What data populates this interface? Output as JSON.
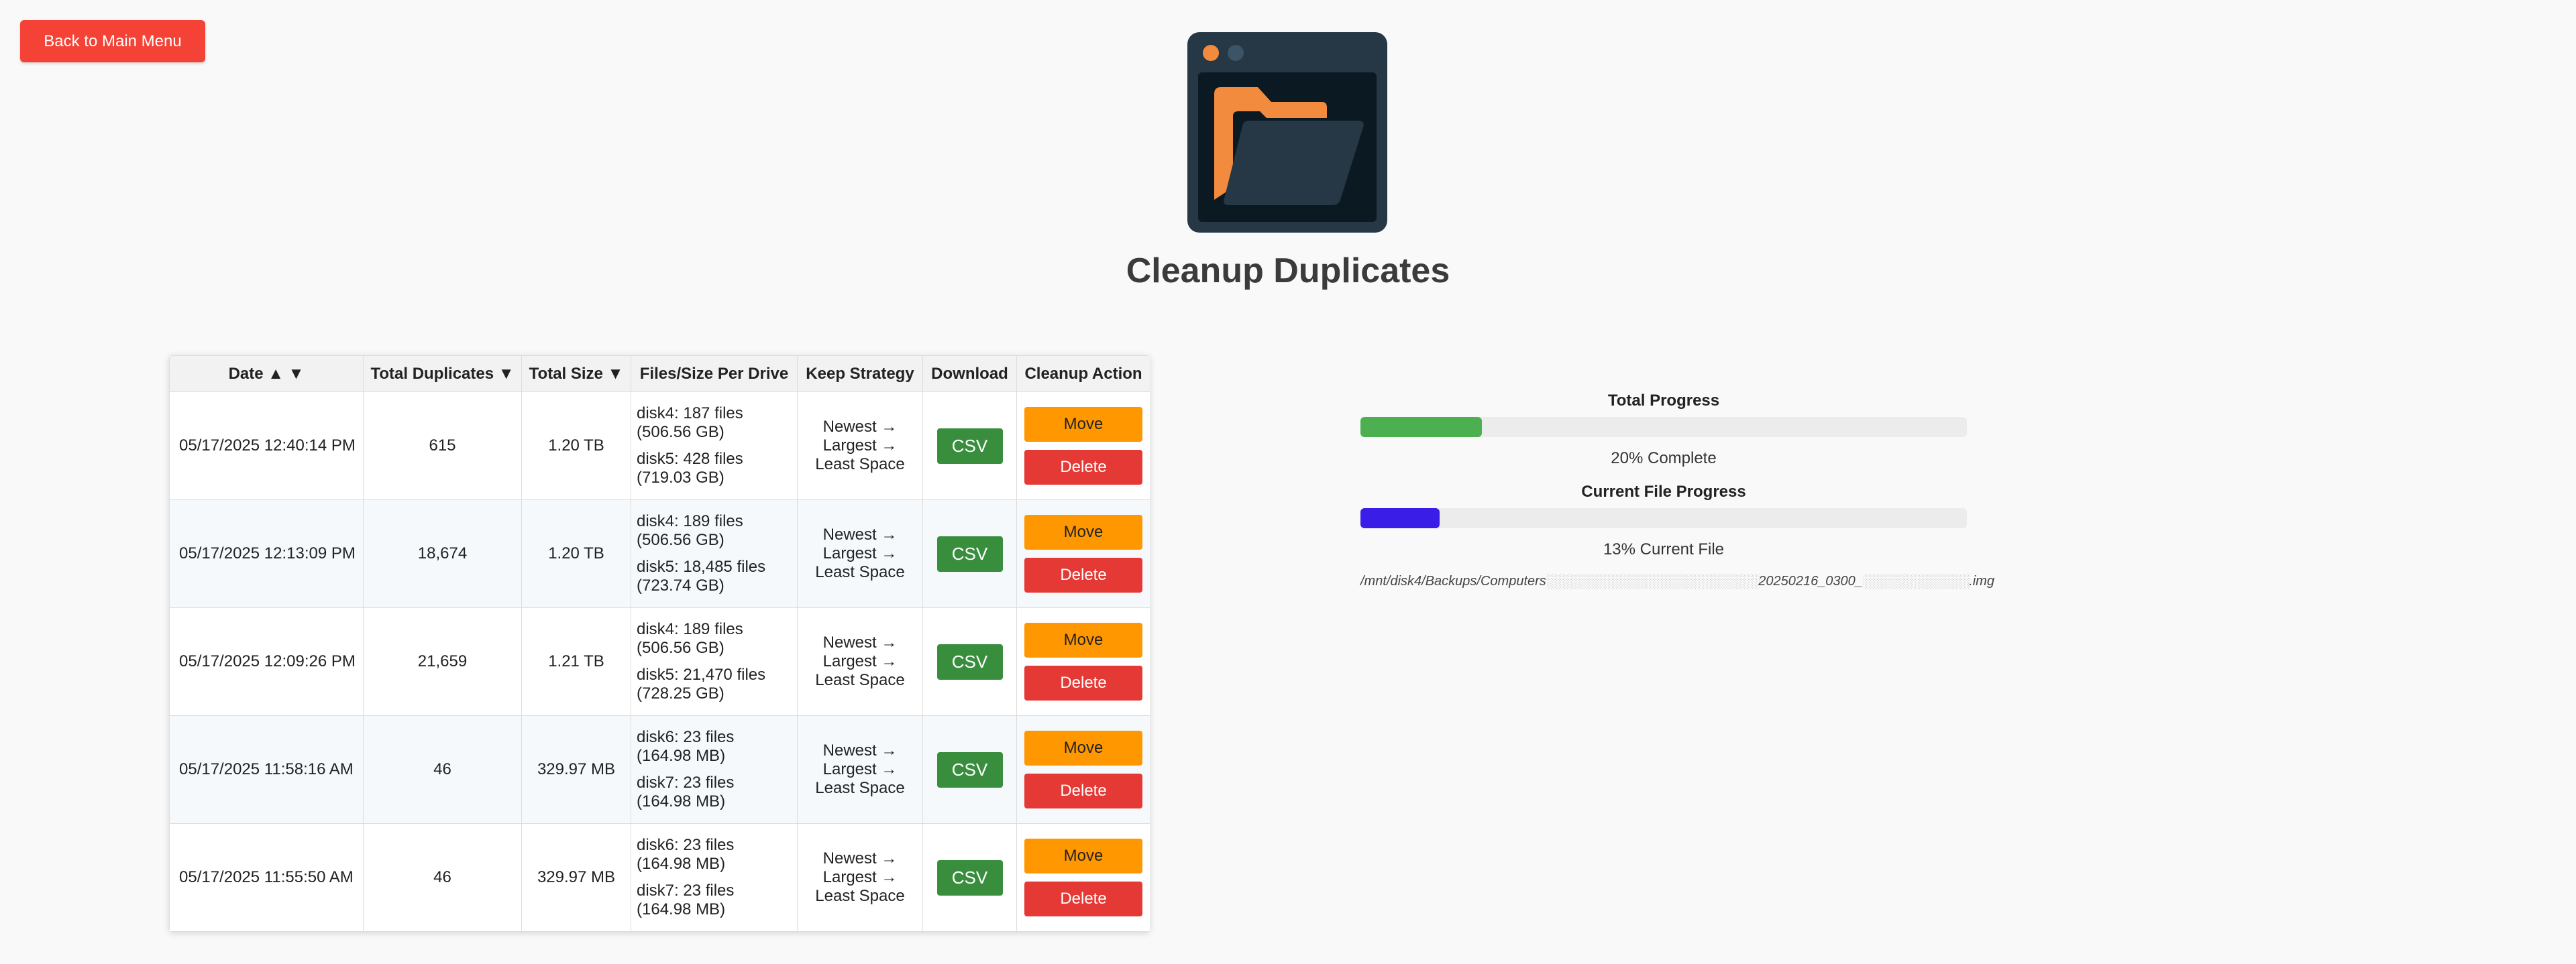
{
  "back_button": "Back to Main Menu",
  "title": "Cleanup Duplicates",
  "table": {
    "headers": {
      "date": "Date ▲ ▼",
      "total": "Total Duplicates ▼",
      "size": "Total Size ▼",
      "per_drive": "Files/Size Per Drive",
      "strategy": "Keep Strategy",
      "download": "Download",
      "action": "Cleanup Action"
    },
    "rows": [
      {
        "date": "05/17/2025 12:40:14 PM",
        "total": "615",
        "size": "1.20 TB",
        "drives": [
          {
            "l1": "disk4: 187 files",
            "l2": "(506.56 GB)"
          },
          {
            "l1": "disk5: 428 files",
            "l2": "(719.03 GB)"
          }
        ]
      },
      {
        "date": "05/17/2025 12:13:09 PM",
        "total": "18,674",
        "size": "1.20 TB",
        "drives": [
          {
            "l1": "disk4: 189 files",
            "l2": "(506.56 GB)"
          },
          {
            "l1": "disk5: 18,485 files",
            "l2": "(723.74 GB)"
          }
        ]
      },
      {
        "date": "05/17/2025 12:09:26 PM",
        "total": "21,659",
        "size": "1.21 TB",
        "drives": [
          {
            "l1": "disk4: 189 files",
            "l2": "(506.56 GB)"
          },
          {
            "l1": "disk5: 21,470 files",
            "l2": "(728.25 GB)"
          }
        ]
      },
      {
        "date": "05/17/2025 11:58:16 AM",
        "total": "46",
        "size": "329.97 MB",
        "drives": [
          {
            "l1": "disk6: 23 files",
            "l2": "(164.98 MB)"
          },
          {
            "l1": "disk7: 23 files",
            "l2": "(164.98 MB)"
          }
        ]
      },
      {
        "date": "05/17/2025 11:55:50 AM",
        "total": "46",
        "size": "329.97 MB",
        "drives": [
          {
            "l1": "disk6: 23 files",
            "l2": "(164.98 MB)"
          },
          {
            "l1": "disk7: 23 files",
            "l2": "(164.98 MB)"
          }
        ]
      }
    ],
    "strategy_lines": [
      "Newest →",
      "Largest →",
      "Least Space"
    ],
    "csv_label": "CSV",
    "move_label": "Move",
    "delete_label": "Delete"
  },
  "progress": {
    "total_label": "Total Progress",
    "total_value": 0.2,
    "total_text": "20% Complete",
    "total_color": "#4caf50",
    "current_label": "Current File Progress",
    "current_value": 0.13,
    "current_text": "13% Current File",
    "current_color": "#3a1de6",
    "file_path_start": "/mnt/disk4/Backups/Computers",
    "file_path_middle": "20250216_0300_",
    "file_path_end": ".img"
  },
  "colors": {
    "back_button": "#f44336",
    "csv_button": "#388e3c",
    "move_button": "#ff9800",
    "delete_button": "#e53935"
  },
  "icons": {
    "logo": "folder-window-icon"
  }
}
